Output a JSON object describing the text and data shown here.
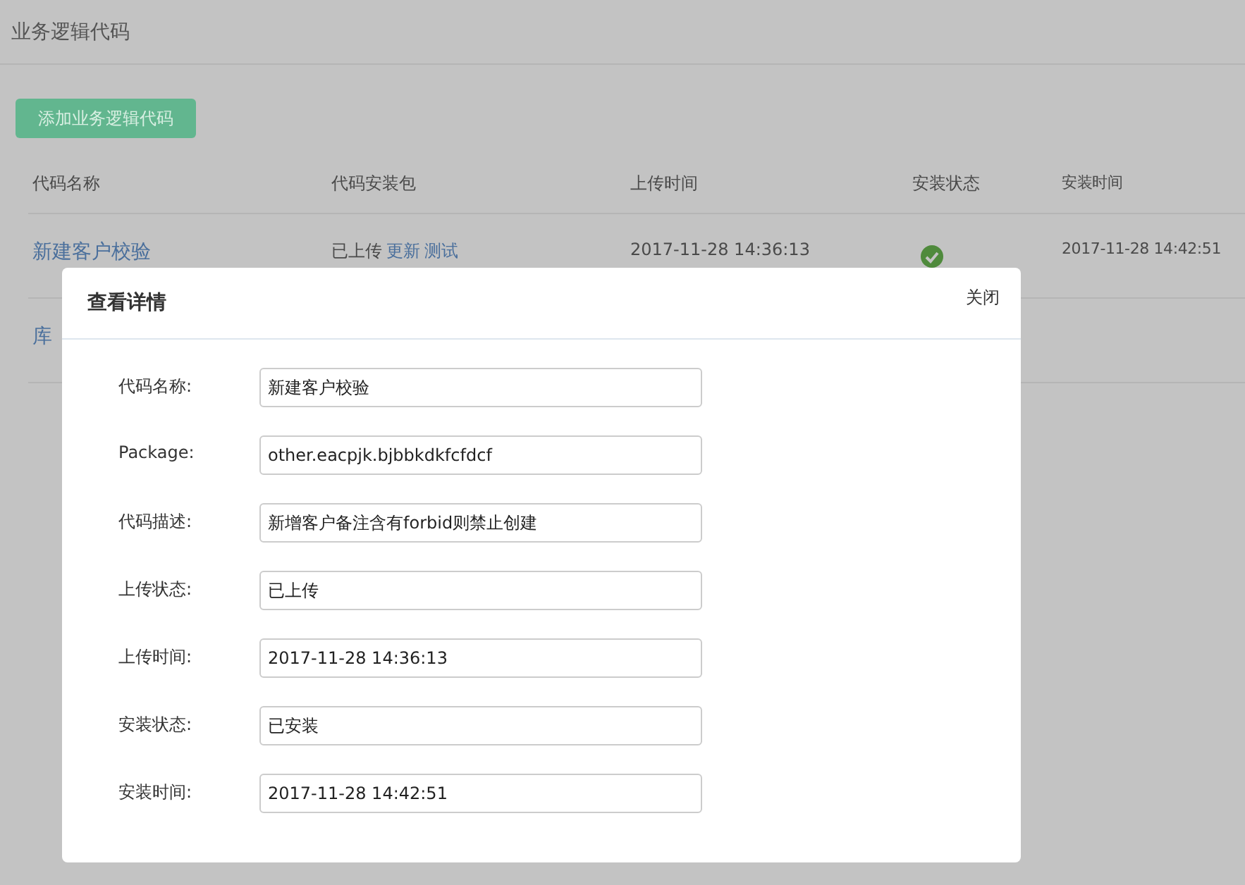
{
  "page": {
    "title": "业务逻辑代码"
  },
  "add_button": "添加业务逻辑代码",
  "table": {
    "columns": [
      "代码名称",
      "代码安装包",
      "上传时间",
      "安装状态",
      "安装时间"
    ],
    "rows": [
      {
        "name": "新建客户校验",
        "package_status": "已上传",
        "package_links": [
          "更新",
          "测试"
        ],
        "upload_time": "2017-11-28 14:36:13",
        "installed": true,
        "install_time": "2017-11-28 14:42:51"
      },
      {
        "name": "库"
      }
    ]
  },
  "dialog": {
    "title": "查看详情",
    "close": "关闭",
    "fields": [
      {
        "label": "代码名称:",
        "value": "新建客户校验"
      },
      {
        "label": "Package:",
        "value": "other.eacpjk.bjbbkdkfcfdcf"
      },
      {
        "label": "代码描述:",
        "value": "新增客户备注含有forbid则禁止创建"
      },
      {
        "label": "上传状态:",
        "value": "已上传"
      },
      {
        "label": "上传时间:",
        "value": "2017-11-28 14:36:13"
      },
      {
        "label": "安装状态:",
        "value": "已安装"
      },
      {
        "label": "安装时间:",
        "value": "2017-11-28 14:42:51"
      }
    ]
  }
}
